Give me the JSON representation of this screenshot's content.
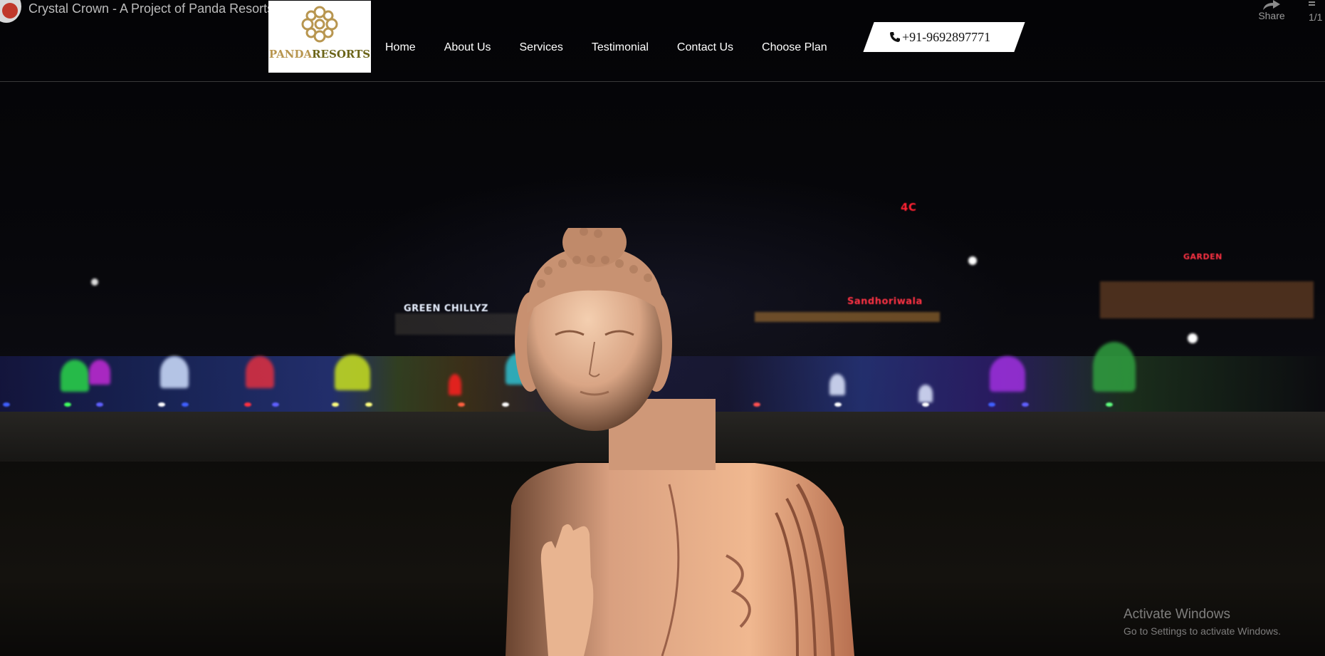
{
  "video": {
    "title": "Crystal Crown - A Project of Panda Resorts",
    "share_label": "Share",
    "playlist_counter": "1/1"
  },
  "header": {
    "logo_text_part1": "PANDA",
    "logo_text_part2": "RESORTS",
    "nav": [
      {
        "label": "Home"
      },
      {
        "label": "About Us"
      },
      {
        "label": "Services"
      },
      {
        "label": "Testimonial"
      },
      {
        "label": "Contact Us"
      },
      {
        "label": "Choose Plan"
      }
    ],
    "phone": "+91-9692897771"
  },
  "scene": {
    "signs": [
      "GREEN CHILLYZ",
      "Sandhoriwala",
      "4C",
      "GARDEN"
    ]
  },
  "watermark": {
    "title": "Activate Windows",
    "subtitle": "Go to Settings to activate Windows."
  },
  "colors": {
    "logo_gold": "#b89650",
    "logo_olive": "#6b6418",
    "background": "#000000"
  },
  "icons": {
    "phone": "phone-icon",
    "share": "share-arrow-icon",
    "logo": "ornament-flower-icon",
    "channel": "channel-avatar-icon",
    "playlist": "playlist-icon"
  }
}
